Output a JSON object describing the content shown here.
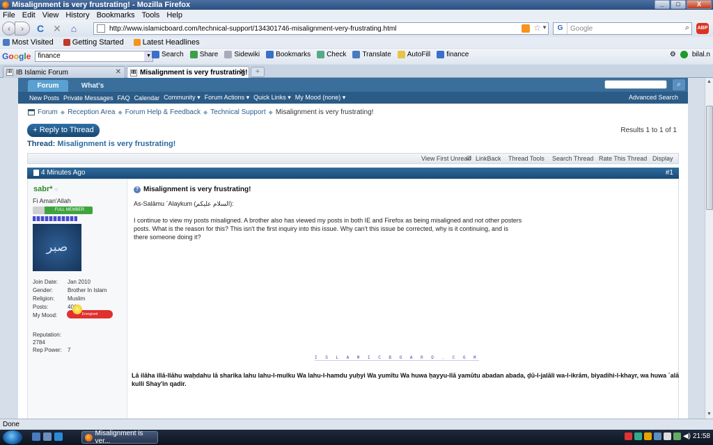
{
  "window": {
    "title": "Misalignment is very frustrating! - Mozilla Firefox",
    "min": "_",
    "max": "□",
    "close": "X"
  },
  "menu": [
    "File",
    "Edit",
    "View",
    "History",
    "Bookmarks",
    "Tools",
    "Help"
  ],
  "nav": {
    "back": "‹",
    "forward": "›",
    "reload": "C",
    "stop": "✕",
    "home": "⌂",
    "url": "http://www.islamicboard.com/technical-support/134301746-misalignment-very-frustrating.html",
    "search_engine": "G",
    "search_placeholder": "Google",
    "abp": "ABP"
  },
  "bookmarks": [
    "Most Visited",
    "Getting Started",
    "Latest Headlines"
  ],
  "google_toolbar": {
    "logo_letters": [
      "G",
      "o",
      "o",
      "g",
      "l",
      "e"
    ],
    "query": "finance",
    "items": [
      "Search",
      "Share",
      "Sidewiki",
      "Bookmarks",
      "Check",
      "Translate",
      "AutoFill",
      "finance"
    ],
    "user": "bilal.n"
  },
  "tabs": [
    {
      "label": "IB Islamic Forum",
      "active": false
    },
    {
      "label": "Misalignment is very frustrating!",
      "active": true
    }
  ],
  "forum": {
    "tab_forum": "Forum",
    "tab_whats_new": "What's New?",
    "subnav": [
      "New Posts",
      "Private Messages",
      "FAQ",
      "Calendar",
      "Community ▾",
      "Forum Actions ▾",
      "Quick Links ▾",
      "My Mood (none) ▾"
    ],
    "advanced_search": "Advanced Search",
    "breadcrumbs": [
      "Forum",
      "Reception Area",
      "Forum Help & Feedback",
      "Technical Support"
    ],
    "breadcrumb_current": "Misalignment is very frustrating!",
    "reply_button": "+ Reply to Thread",
    "results": "Results 1 to 1 of 1",
    "thread_label": "Thread:",
    "thread_title": "Misalignment is very frustrating!",
    "tools": [
      "View First Unread",
      "LinkBack",
      "Thread Tools",
      "Search Thread",
      "Rate This Thread",
      "Display"
    ]
  },
  "post": {
    "date": "4 Minutes Ago",
    "number": "#1",
    "user": {
      "name": "sabr*",
      "title": "Fi Aman'Allah",
      "badge": "FULL MEMBER",
      "avatar_text": "صبر",
      "join_date_label": "Join Date:",
      "join_date": "Jan 2010",
      "gender_label": "Gender:",
      "gender": "Brother In Islam",
      "religion_label": "Religion:",
      "religion": "Muslim",
      "posts_label": "Posts:",
      "posts": "401",
      "mood_label": "My Mood:",
      "mood": "Energized",
      "reputation_label": "Reputation:",
      "reputation": "2784",
      "rep_power_label": "Rep Power:",
      "rep_power": "7"
    },
    "title": "Misalignment is very frustrating!",
    "greeting": "As-Salāmu `Alaykum (السلام عليكم):",
    "body": "I continue to view my posts misaligned. A brother also has viewed my posts in both IE and Firefox as being misaligned and not other posters posts. What is the reason for this? This isn't the first inquiry into this issue. Why can't this issue be corrected, why is it continuing, and is there someone doing it?",
    "sig_link": "I S L A M I C B O A R D . C O M",
    "signature": "Lā ilāha illā-llāhu waḥdahu lā sharika lahu lahu-l-mulku Wa lahu-l-hamdu yuḥyi Wa yumītu Wa huwa ḥayyu-llā yamūtu abadan abada, ḏū-l-jalāli wa-l-ikrām, biyadihi-l-khayr, wa huwa `alā kulli Shay'in qadir."
  },
  "status": "Done",
  "taskbar": {
    "item": "Misalignment is ver...",
    "clock": "21:58"
  }
}
